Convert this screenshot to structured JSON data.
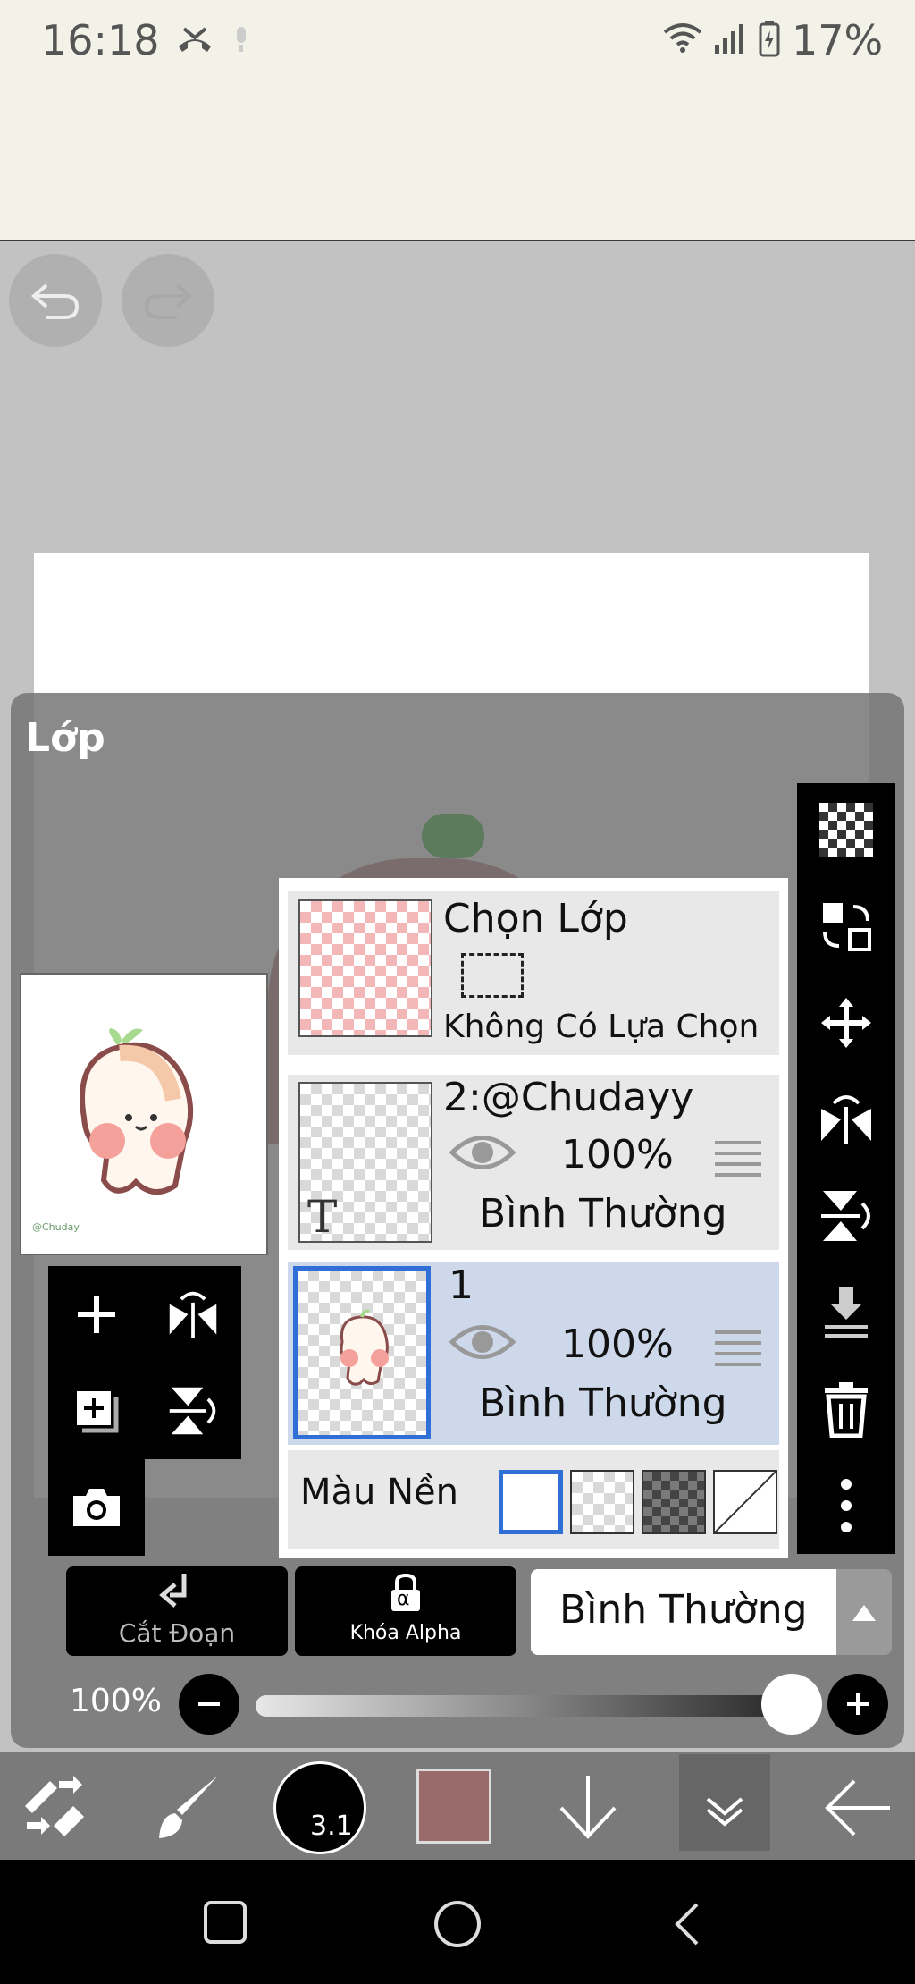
{
  "status": {
    "time": "16:18",
    "battery": "17%"
  },
  "panel": {
    "title": "Lớp"
  },
  "selection_layer": {
    "title": "Chọn Lớp",
    "subtitle": "Không Có Lựa Chọn"
  },
  "layers": [
    {
      "name": "2:@Chudayy",
      "opacity": "100%",
      "blend": "Bình Thường",
      "type_mark": "T"
    },
    {
      "name": "1",
      "opacity": "100%",
      "blend": "Bình Thường"
    }
  ],
  "background": {
    "label": "Màu Nền"
  },
  "buttons": {
    "clip": "Cắt Đoạn",
    "alpha_lock": "Khóa Alpha",
    "alpha_glyph": "α",
    "blend_mode": "Bình Thường"
  },
  "opacity": {
    "label": "100%",
    "value": 100
  },
  "toolbar": {
    "brush_size": "3.1",
    "color": "#9a6b6b"
  },
  "thumbnail": {
    "signature": "@Chuday"
  },
  "colors": {
    "accent": "#2f6fd6",
    "selected_row": "#cdd8ea"
  }
}
